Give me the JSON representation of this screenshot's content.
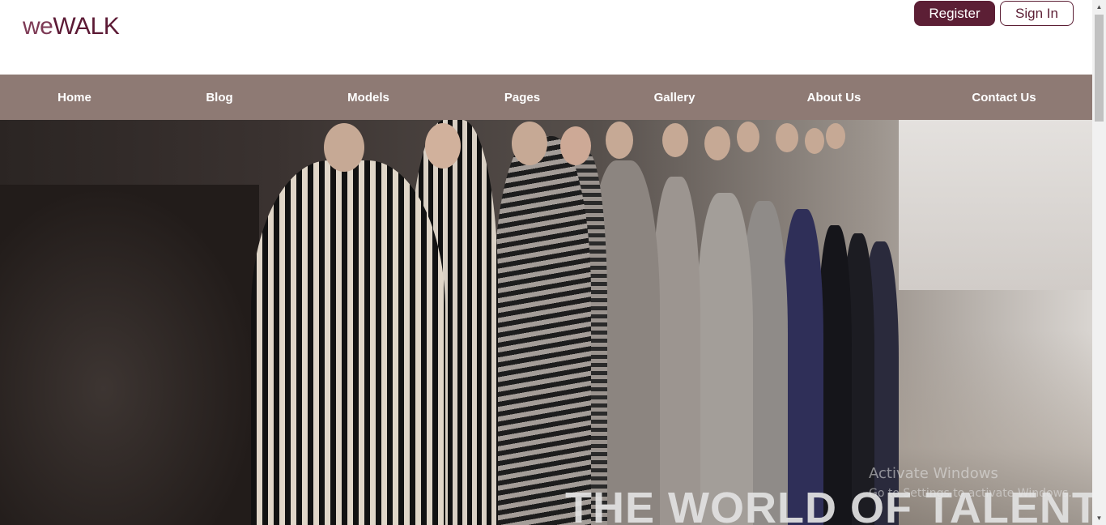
{
  "header": {
    "logo_prefix": "we",
    "logo_suffix": "WALK",
    "register_label": "Register",
    "signin_label": "Sign In"
  },
  "nav": {
    "items": [
      {
        "label": "Home"
      },
      {
        "label": "Blog"
      },
      {
        "label": "Models"
      },
      {
        "label": "Pages"
      },
      {
        "label": "Gallery"
      },
      {
        "label": "About Us"
      },
      {
        "label": "Contact Us"
      }
    ]
  },
  "hero": {
    "title": "THE WORLD OF TALENT",
    "image_description": "runway-fashion-show-photo"
  },
  "watermark": {
    "line1": "Activate Windows",
    "line2": "Go to Settings to activate Windows."
  },
  "colors": {
    "brand": "#5c1f35",
    "nav_bg": "#8e7a74",
    "logo_we": "#7d3a55"
  },
  "scrollbar": {
    "up_icon": "chevron-up-icon",
    "down_icon": "chevron-down-icon"
  }
}
